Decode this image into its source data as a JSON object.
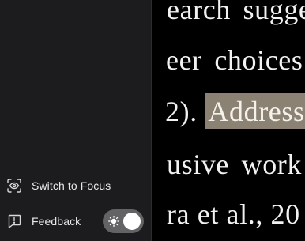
{
  "sidebar": {
    "focus_item": {
      "label": "Switch to Focus",
      "icon": "eye-scan-icon"
    },
    "feedback_item": {
      "label": "Feedback",
      "icon": "feedback-icon"
    },
    "theme_toggle": {
      "state": "light",
      "icon": "sun-icon"
    }
  },
  "document": {
    "lines": [
      "earch sugge",
      "eer choices",
      "2). ",
      "usive work",
      "ra et al., 20"
    ],
    "highlighted_text": "Address"
  },
  "colors": {
    "sidebar_bg": "#1c1c1e",
    "doc_bg": "#000000",
    "highlight": "#8b8274",
    "toggle_track": "#636366"
  }
}
